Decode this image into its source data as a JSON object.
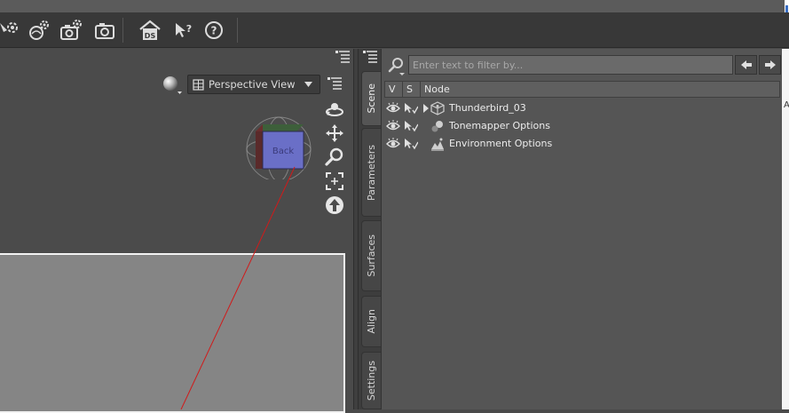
{
  "toolbar": {
    "icons": [
      "light-settings-icon",
      "render-settings-icon",
      "camera-settings-icon",
      "camera-icon",
      "home-ds-icon",
      "help-pointer-icon",
      "help-icon"
    ],
    "ds_label": "DS"
  },
  "viewport": {
    "view_name": "Perspective View",
    "cube_face_label": "Back",
    "colors": {
      "canvas": "#858585",
      "guide_line": "#d11a1a"
    }
  },
  "side_tabs": [
    {
      "label": "Scene",
      "active": true
    },
    {
      "label": "Parameters",
      "active": false
    },
    {
      "label": "Surfaces",
      "active": false
    },
    {
      "label": "Align",
      "active": false
    },
    {
      "label": "Settings",
      "active": false
    }
  ],
  "scene": {
    "filter_placeholder": "Enter text to filter by...",
    "columns": {
      "visible": "V",
      "selectable": "S",
      "node": "Node"
    },
    "nodes": [
      {
        "label": "Thunderbird_03",
        "icon": "figure-cube-icon",
        "expandable": true
      },
      {
        "label": "Tonemapper Options",
        "icon": "tonemapper-icon",
        "expandable": false
      },
      {
        "label": "Environment Options",
        "icon": "environment-icon",
        "expandable": false
      }
    ]
  },
  "edge_letter": "A"
}
